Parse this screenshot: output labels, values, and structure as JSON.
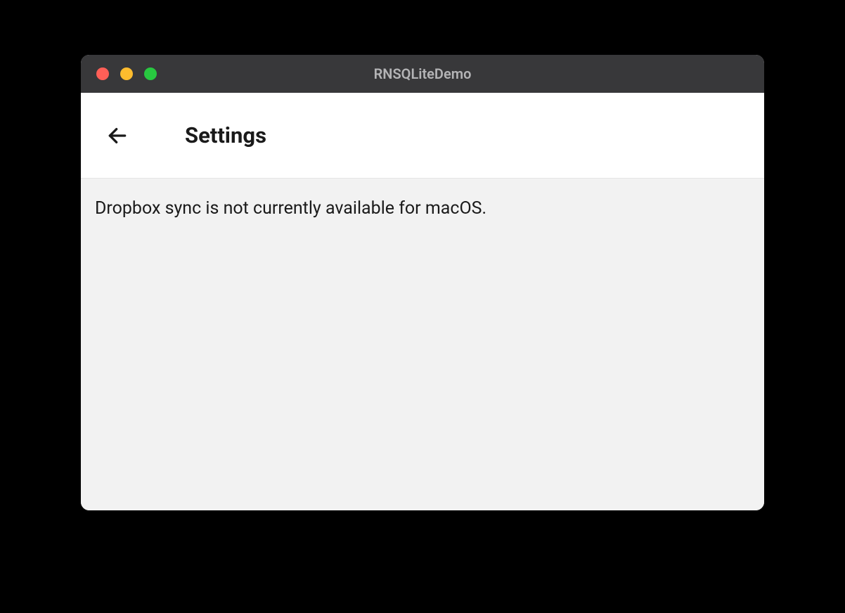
{
  "window": {
    "title": "RNSQLiteDemo"
  },
  "header": {
    "page_title": "Settings"
  },
  "content": {
    "status_message": "Dropbox sync is not currently available for macOS."
  }
}
